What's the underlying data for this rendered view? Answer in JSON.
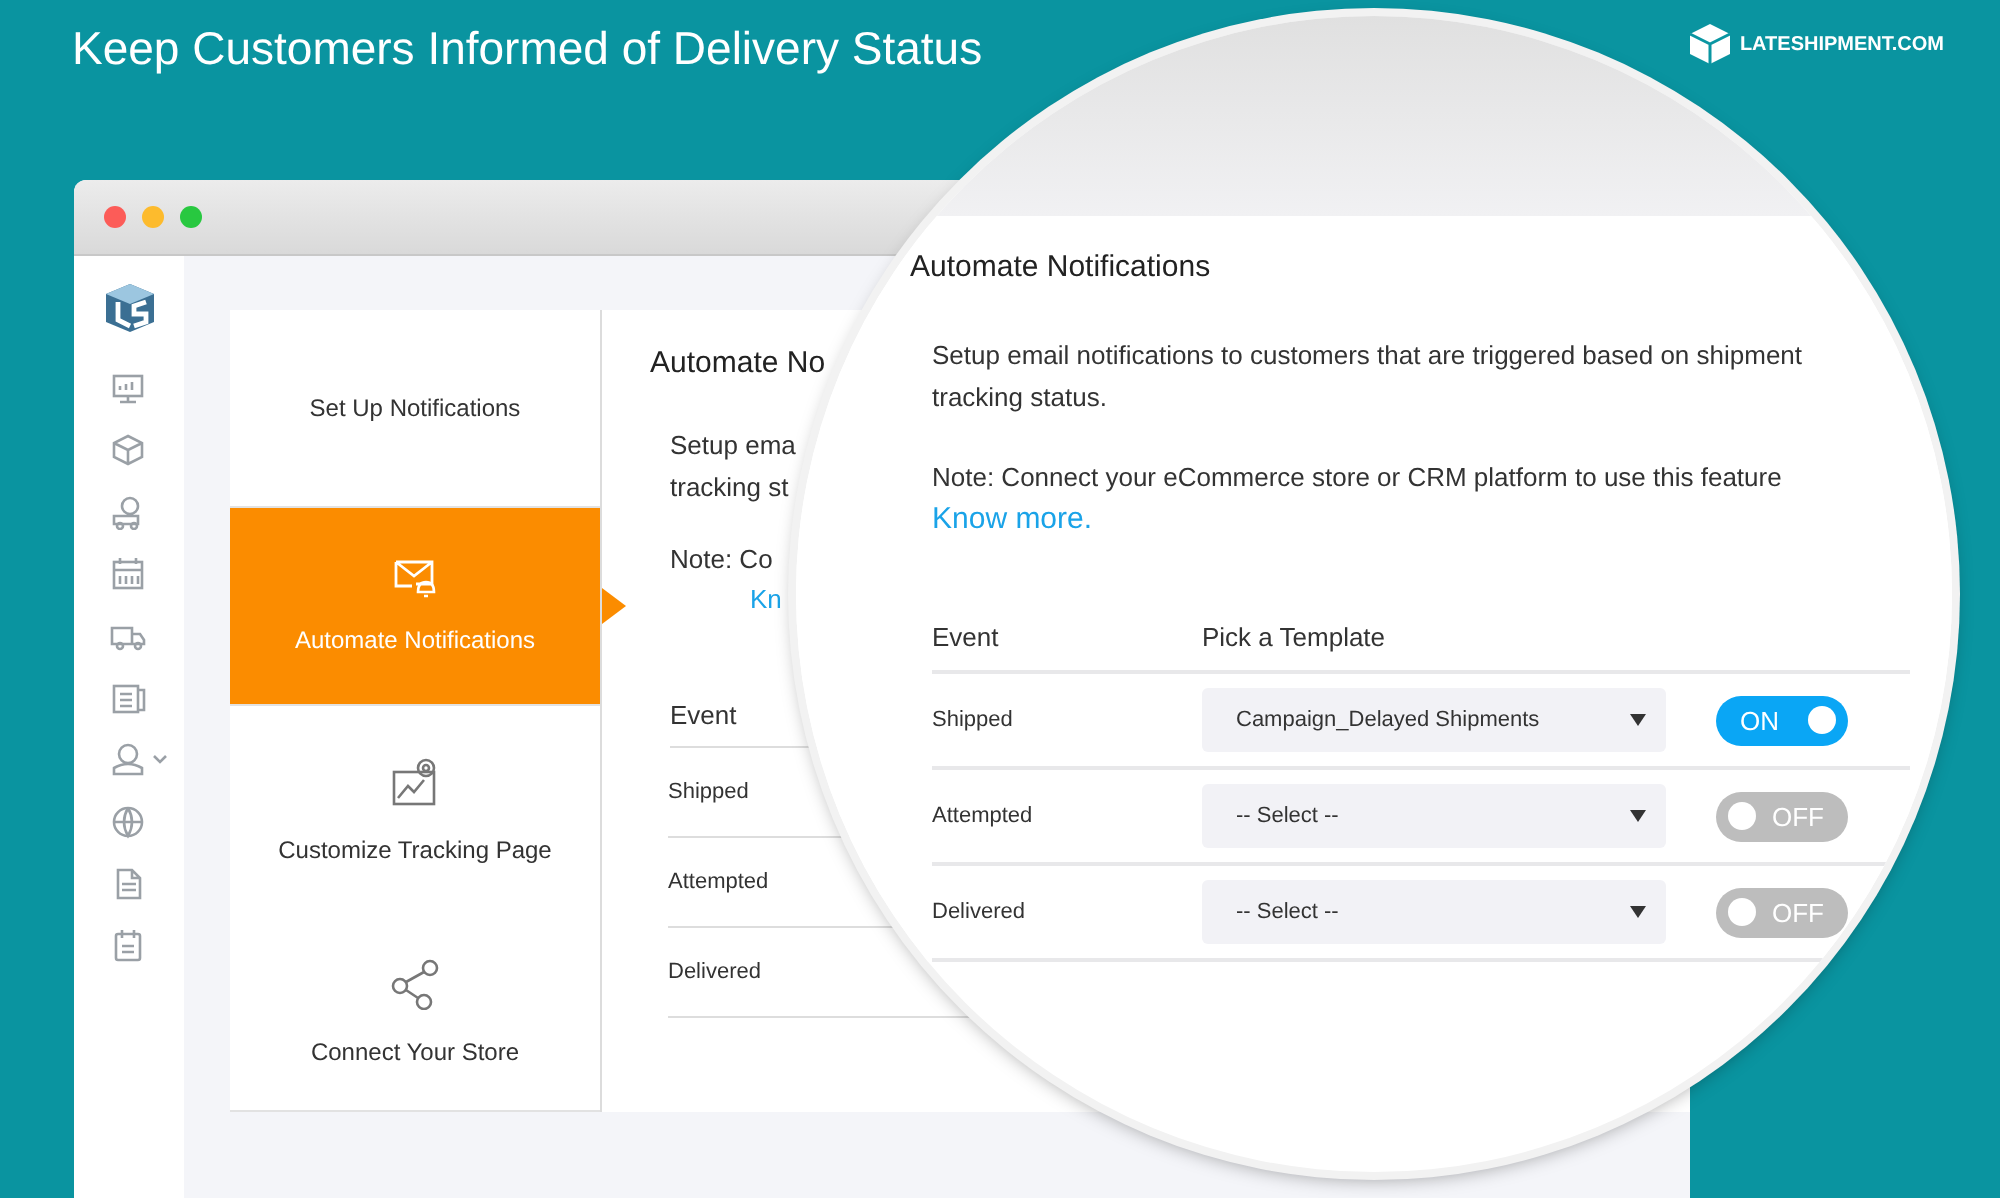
{
  "banner": {
    "headline": "Keep Customers Informed of Delivery Status",
    "brand": "LATESHIPMENT.COM"
  },
  "steps": [
    {
      "label": "Set Up Notifications",
      "selected": false
    },
    {
      "label": "Automate Notifications",
      "selected": true
    },
    {
      "label": "Customize Tracking Page",
      "selected": false
    },
    {
      "label": "Connect Your Store",
      "selected": false
    }
  ],
  "back_panel": {
    "title": "Automate No",
    "lines": [
      "Setup ema",
      "tracking st"
    ],
    "note": "Note: Co",
    "link": "Kn",
    "event_header": "Event",
    "events": [
      "Shipped",
      "Attempted",
      "Delivered"
    ]
  },
  "magnifier": {
    "title": "Automate Notifications",
    "description": "Setup email notifications to customers that are triggered based on shipment tracking status.",
    "note": "Note: Connect your eCommerce store or CRM platform to use this feature",
    "link": "Know more.",
    "columns": [
      "Event",
      "Pick a Template"
    ],
    "rows": [
      {
        "event": "Shipped",
        "template": "Campaign_Delayed Shipments",
        "on": true,
        "toggle_label": "ON"
      },
      {
        "event": "Attempted",
        "template": "-- Select --",
        "on": false,
        "toggle_label": "OFF"
      },
      {
        "event": "Delivered",
        "template": "-- Select --",
        "on": false,
        "toggle_label": "OFF"
      }
    ]
  }
}
